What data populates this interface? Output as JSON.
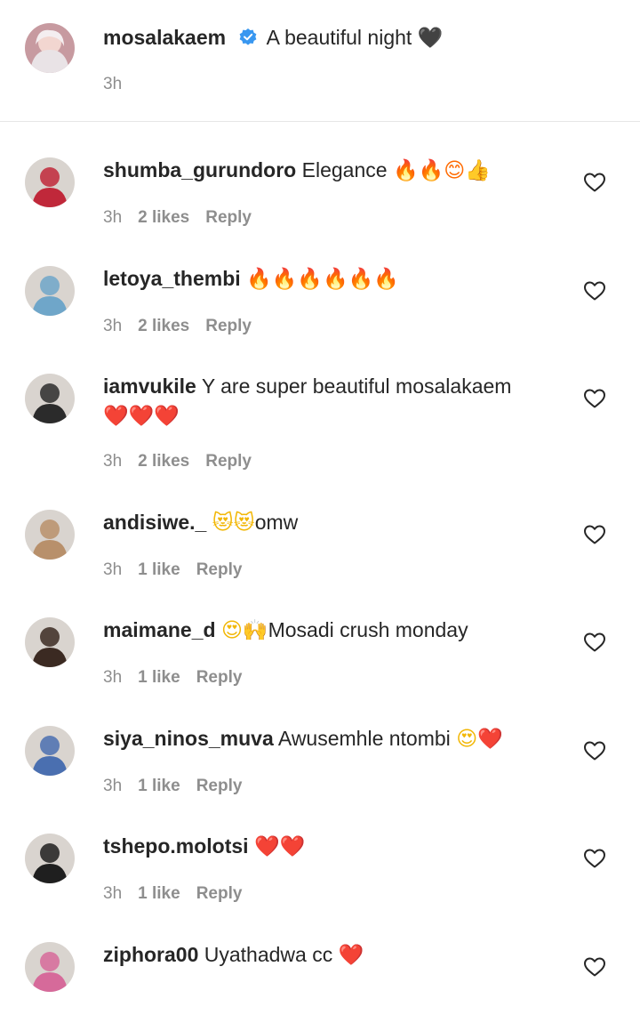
{
  "caption": {
    "username": "mosalakaem",
    "text": "A beautiful night",
    "emoji": "🖤",
    "time": "3h"
  },
  "comments": [
    {
      "username": "shumba_gurundoro",
      "text": "Elegance",
      "emoji": "🔥🔥😊👍",
      "line2": "",
      "time": "3h",
      "likes": "2 likes",
      "reply": "Reply",
      "avatar_color": "#c0283a"
    },
    {
      "username": "letoya_thembi",
      "text": "",
      "emoji": "🔥🔥🔥🔥🔥🔥",
      "line2": "",
      "time": "3h",
      "likes": "2 likes",
      "reply": "Reply",
      "avatar_color": "#6fa6c9"
    },
    {
      "username": "iamvukile",
      "text": "Y are super beautiful mosalakaem",
      "emoji": "",
      "line2": "❤️❤️❤️",
      "time": "3h",
      "likes": "2 likes",
      "reply": "Reply",
      "avatar_color": "#2b2b2b"
    },
    {
      "username": "andisiwe._",
      "text": "omw",
      "emoji": "😻😻",
      "line2": "",
      "time": "3h",
      "likes": "1 like",
      "reply": "Reply",
      "avatar_color": "#b8906b"
    },
    {
      "username": "maimane_d",
      "text": "Mosadi crush monday",
      "emoji": "😍🙌",
      "line2": "",
      "time": "3h",
      "likes": "1 like",
      "reply": "Reply",
      "avatar_color": "#3b2a22"
    },
    {
      "username": "siya_ninos_muva",
      "text": "Awusemhle ntombi",
      "emoji": "😍❤️",
      "line2": "",
      "time": "3h",
      "likes": "1 like",
      "reply": "Reply",
      "avatar_color": "#4a6fb0"
    },
    {
      "username": "tshepo.molotsi",
      "text": "",
      "emoji": "❤️❤️",
      "line2": "",
      "time": "3h",
      "likes": "1 like",
      "reply": "Reply",
      "avatar_color": "#1f1f1f"
    },
    {
      "username": "ziphora00",
      "text": "Uyathadwa cc",
      "emoji": "❤️",
      "line2": "",
      "time": "",
      "likes": "",
      "reply": "",
      "avatar_color": "#d66a9a"
    }
  ],
  "icons": {
    "verified": "verified-badge-icon",
    "like": "heart-outline-icon"
  },
  "colors": {
    "text": "#262626",
    "meta": "#8e8e8e",
    "verified": "#3897f0"
  }
}
